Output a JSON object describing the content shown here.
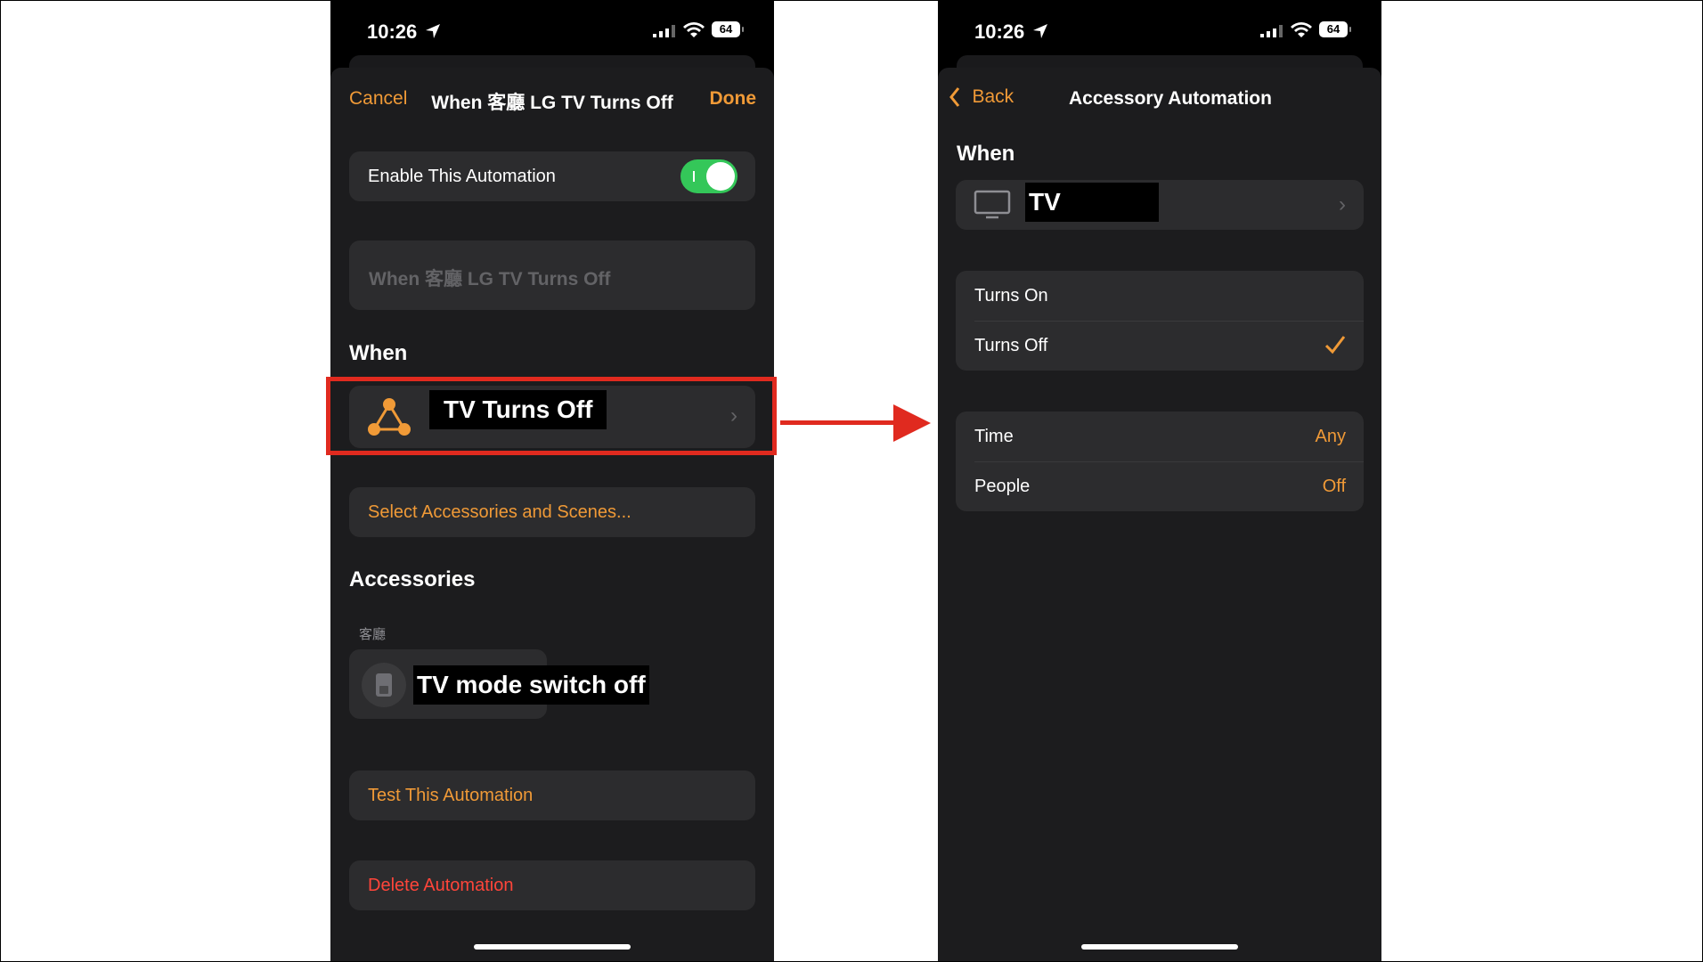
{
  "status": {
    "time": "10:26",
    "battery": "64"
  },
  "left": {
    "nav": {
      "cancel": "Cancel",
      "title": "When 客廳 LG TV Turns Off",
      "done": "Done"
    },
    "enable_label": "Enable This Automation",
    "enable_on": true,
    "name_placeholder": "When 客廳 LG TV Turns Off",
    "when_title": "When",
    "trigger_label": "TV Turns Off",
    "select_label": "Select Accessories and Scenes...",
    "accessories_title": "Accessories",
    "room_label": "客廳",
    "accessory_label": "TV mode switch off",
    "test_label": "Test This Automation",
    "delete_label": "Delete Automation"
  },
  "right": {
    "nav": {
      "back": "Back",
      "title": "Accessory Automation"
    },
    "when_title": "When",
    "device_label": "TV",
    "options": [
      {
        "label": "Turns On",
        "checked": false
      },
      {
        "label": "Turns Off",
        "checked": true
      }
    ],
    "conditions": [
      {
        "label": "Time",
        "value": "Any"
      },
      {
        "label": "People",
        "value": "Off"
      }
    ]
  },
  "colors": {
    "accent": "#f09a37",
    "destructive": "#ff453a",
    "toggle_on": "#34c759",
    "annotation": "#e02a1f"
  }
}
